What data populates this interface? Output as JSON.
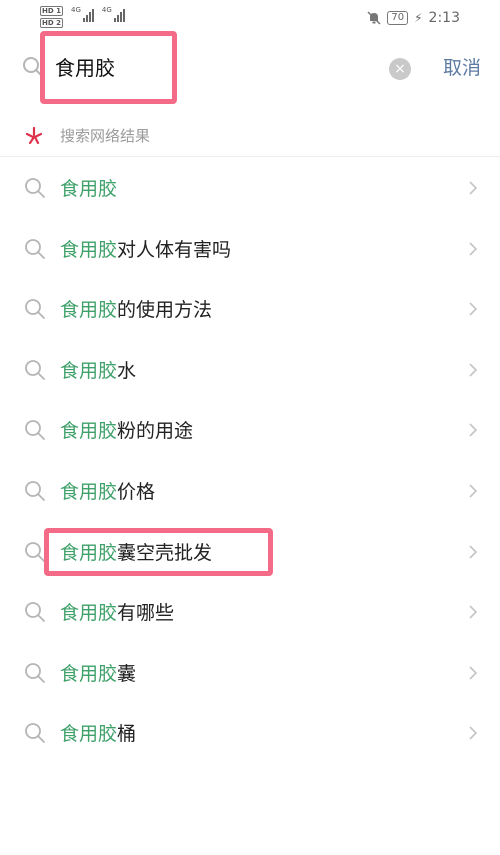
{
  "status_bar": {
    "hd1": "HD 1",
    "hd2": "HD 2",
    "net1": "4G",
    "net2": "4G",
    "battery": "70",
    "time": "2:13"
  },
  "search": {
    "query": "食用胶",
    "cancel_label": "取消",
    "clear_icon": "×"
  },
  "network_section": {
    "label": "搜索网络结果"
  },
  "suggestions": [
    {
      "keyword": "食用胶",
      "rest": ""
    },
    {
      "keyword": "食用胶",
      "rest": "对人体有害吗"
    },
    {
      "keyword": "食用胶",
      "rest": "的使用方法"
    },
    {
      "keyword": "食用胶",
      "rest": "水"
    },
    {
      "keyword": "食用胶",
      "rest": "粉的用途"
    },
    {
      "keyword": "食用胶",
      "rest": "价格"
    },
    {
      "keyword": "食用胶",
      "rest": "囊空壳批发"
    },
    {
      "keyword": "食用胶",
      "rest": "有哪些"
    },
    {
      "keyword": "食用胶",
      "rest": "囊"
    },
    {
      "keyword": "食用胶",
      "rest": "桶"
    }
  ],
  "colors": {
    "keyword_green": "#3fa16a",
    "cancel_blue": "#5d7ba3",
    "highlight_pink": "#f36b86",
    "network_red": "#e0314b"
  }
}
